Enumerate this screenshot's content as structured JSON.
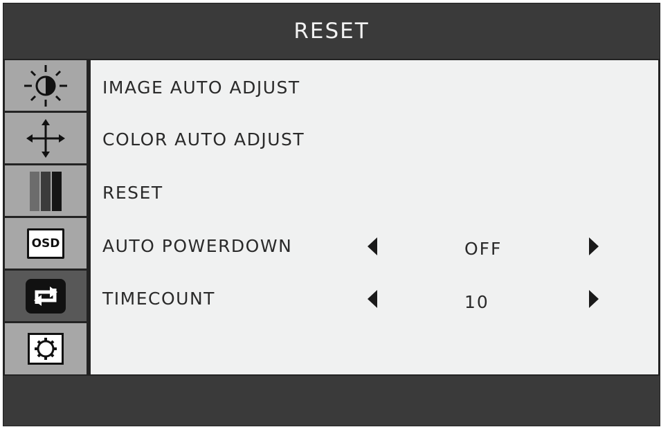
{
  "header": {
    "title": "RESET"
  },
  "sidebar": {
    "tabs": [
      {
        "icon": "brightness-contrast-icon",
        "active": false
      },
      {
        "icon": "move-arrows-icon",
        "active": false
      },
      {
        "icon": "color-bars-icon",
        "active": false
      },
      {
        "icon": "osd-icon",
        "label": "OSD",
        "active": false
      },
      {
        "icon": "reset-arrows-icon",
        "active": true
      },
      {
        "icon": "gear-icon",
        "active": false
      }
    ]
  },
  "menu": {
    "items": [
      {
        "label": "IMAGE AUTO ADJUST"
      },
      {
        "label": "COLOR AUTO ADJUST"
      },
      {
        "label": "RESET"
      },
      {
        "label": "AUTO POWERDOWN",
        "value": "OFF"
      },
      {
        "label": "TIMECOUNT",
        "value": "10"
      }
    ]
  },
  "colors": {
    "frame": "#3a3a3a",
    "sidebar_tab": "#a7a7a7",
    "sidebar_tab_active": "#585858",
    "content_background": "#f0f1f1",
    "text": "#2a2a2a"
  }
}
